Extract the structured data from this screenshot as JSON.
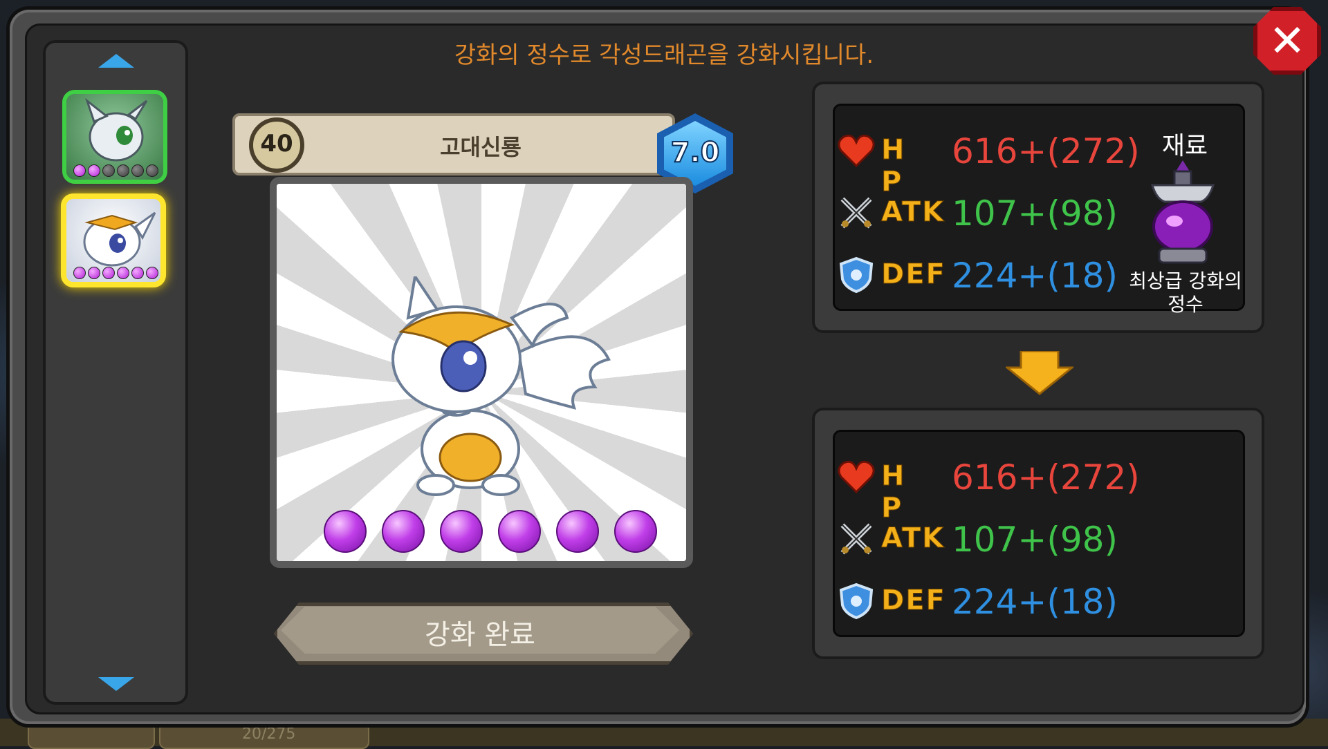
{
  "instruction": "강화의 정수로 각성드래곤을 강화시킵니다.",
  "dragon": {
    "level": "40",
    "name": "고대신룡",
    "grade": "7.0",
    "stars_filled": 6,
    "stars_total": 6
  },
  "side_list": {
    "items": [
      {
        "name": "dragon-portrait-green",
        "stars_filled": 2,
        "stars_total": 6,
        "selected": false
      },
      {
        "name": "dragon-portrait-gold",
        "stars_filled": 6,
        "stars_total": 6,
        "selected": true
      }
    ]
  },
  "buttons": {
    "complete_label": "강화 완료"
  },
  "current_stats": {
    "hp_label": "H P",
    "hp_value": "616+(272)",
    "atk_label": "ATK",
    "atk_value": "107+(98)",
    "def_label": "DEF",
    "def_value": "224+(18)"
  },
  "result_stats": {
    "hp_label": "H P",
    "hp_value": "616+(272)",
    "atk_label": "ATK",
    "atk_value": "107+(98)",
    "def_label": "DEF",
    "def_value": "224+(18)"
  },
  "material": {
    "title": "재료",
    "name": "최상급 강화의 정수"
  },
  "bottom_strip": {
    "text": "20/275"
  },
  "colors": {
    "instruction": "#e1892b",
    "hp": "#e8453c",
    "atk": "#3fc34a",
    "def": "#2f8fe0",
    "star": "#c03ee8",
    "selected_border": "#ffe62e"
  }
}
